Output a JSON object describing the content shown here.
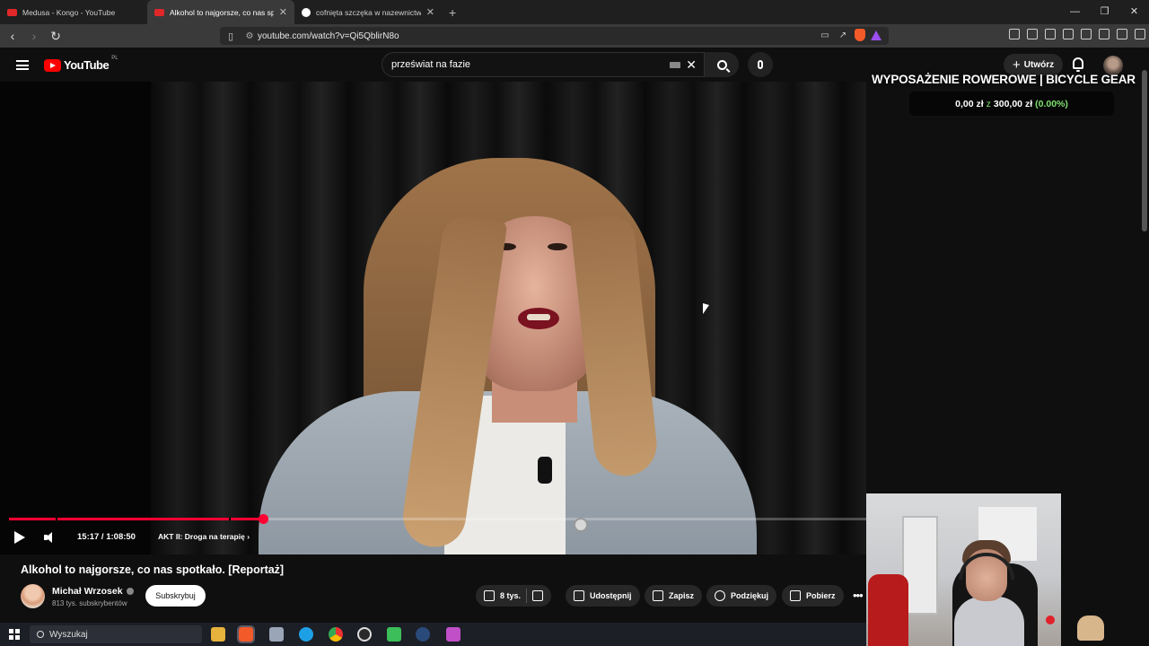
{
  "browser": {
    "tabs": [
      {
        "title": "Medusa - Kongo - YouTube",
        "active": false
      },
      {
        "title": "Alkohol to najgorsze, co nas spo",
        "active": true
      },
      {
        "title": "cofnięta szczęka w nazewnictwie leka",
        "active": false
      }
    ],
    "url": "youtube.com/watch?v=Qi5QblirN8o"
  },
  "youtube": {
    "logo_text": "YouTube",
    "country_code": "PL",
    "search_value": "przeświat na fazie",
    "create_label": "Utwórz"
  },
  "video": {
    "time": "15:17 / 1:08:50",
    "chapter": "AKT II: Droga na terapię",
    "progress_fraction": 0.296,
    "title": "Alkohol to najgorsze, co nas spotkało. [Reportaż]"
  },
  "channel": {
    "name": "Michał Wrzosek",
    "subscribers": "813 tys. subskrybentów",
    "subscribe_label": "Subskrybuj"
  },
  "actions": {
    "likes": "8 tys.",
    "share": "Udostępnij",
    "save": "Zapisz",
    "thanks": "Podziękuj",
    "download": "Pobierz"
  },
  "overlay": {
    "title": "WYPOSAŻENIE ROWEROWE | BICYCLE GEAR",
    "goal_current": "0,00 zł",
    "goal_sep": "z",
    "goal_target": "300,00 zł",
    "goal_percent": "(0.00%)"
  },
  "taskbar": {
    "search_placeholder": "Wyszukaj"
  },
  "colors": {
    "accent_red": "#ff0033",
    "goal_green": "#7ee06e",
    "bg": "#0f0f0f"
  }
}
